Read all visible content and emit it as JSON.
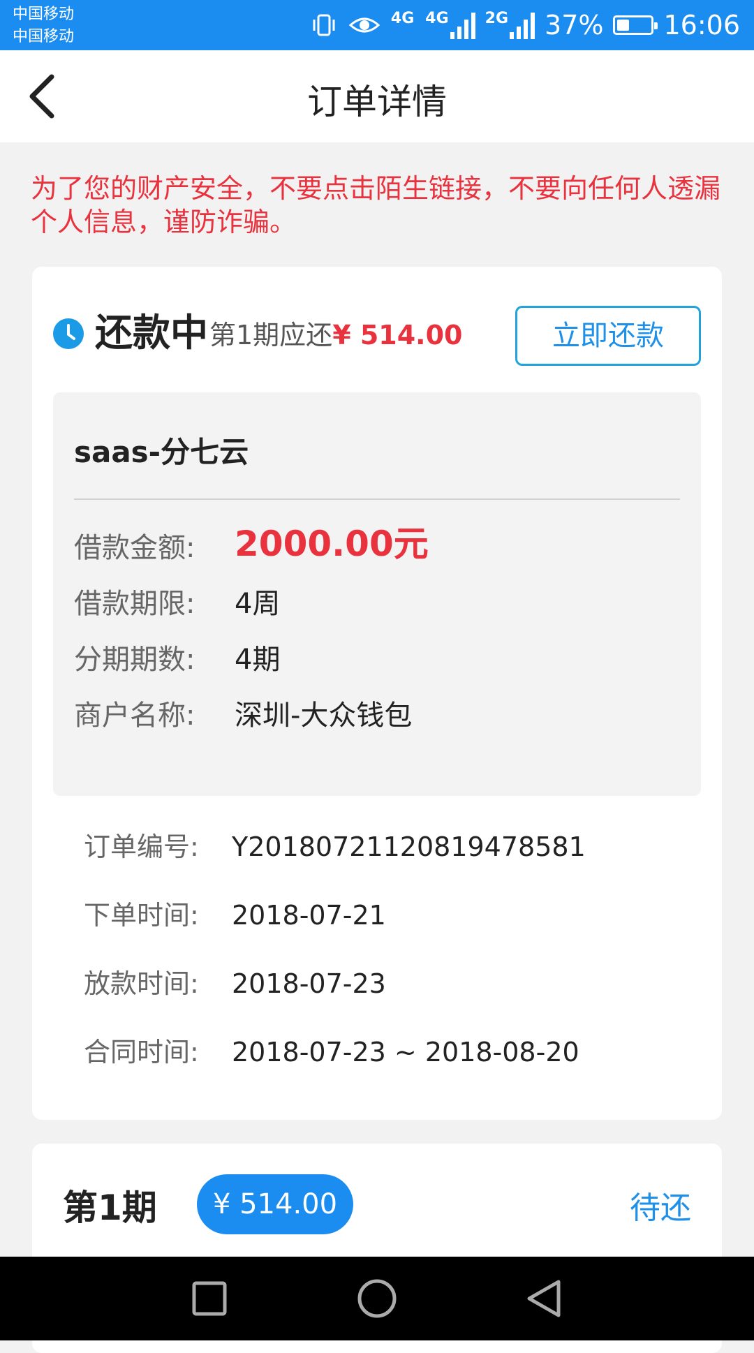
{
  "status_bar": {
    "carrier1": "中国移动",
    "carrier2": "中国移动",
    "net1": "4G",
    "net2": "4G",
    "net3": "2G",
    "battery": "37%",
    "battery_level": 0.37,
    "time": "16:06"
  },
  "header": {
    "title": "订单详情",
    "back_icon": "chevron-left-icon"
  },
  "warning": "为了您的财产安全，不要点击陌生链接，不要向任何人透漏个人信息，谨防诈骗。",
  "order": {
    "status": "还款中",
    "due_label": "第1期应还",
    "due_amount": "¥ 514.00",
    "repay_button": "立即还款",
    "product_name": "saas-分七云",
    "loan_fields": [
      {
        "label": "借款金额:",
        "value": "2000.00元"
      },
      {
        "label": "借款期限:",
        "value": "4周"
      },
      {
        "label": "分期期数:",
        "value": "4期"
      },
      {
        "label": "商户名称:",
        "value": "深圳-大众钱包"
      }
    ],
    "info_fields": [
      {
        "label": "订单编号:",
        "value": "Y2018072112081947858​1"
      },
      {
        "label": "下单时间:",
        "value": "2018-07-21"
      },
      {
        "label": "放款时间:",
        "value": "2018-07-23"
      },
      {
        "label": "合同时间:",
        "value": "2018-07-23 ~ 2018-08-20"
      }
    ]
  },
  "period": {
    "title": "第1期",
    "amount": "¥ 514.00",
    "status": "待还"
  },
  "colors": {
    "accent": "#1b8cf0",
    "danger": "#e8333f",
    "link": "#1e90e8"
  }
}
